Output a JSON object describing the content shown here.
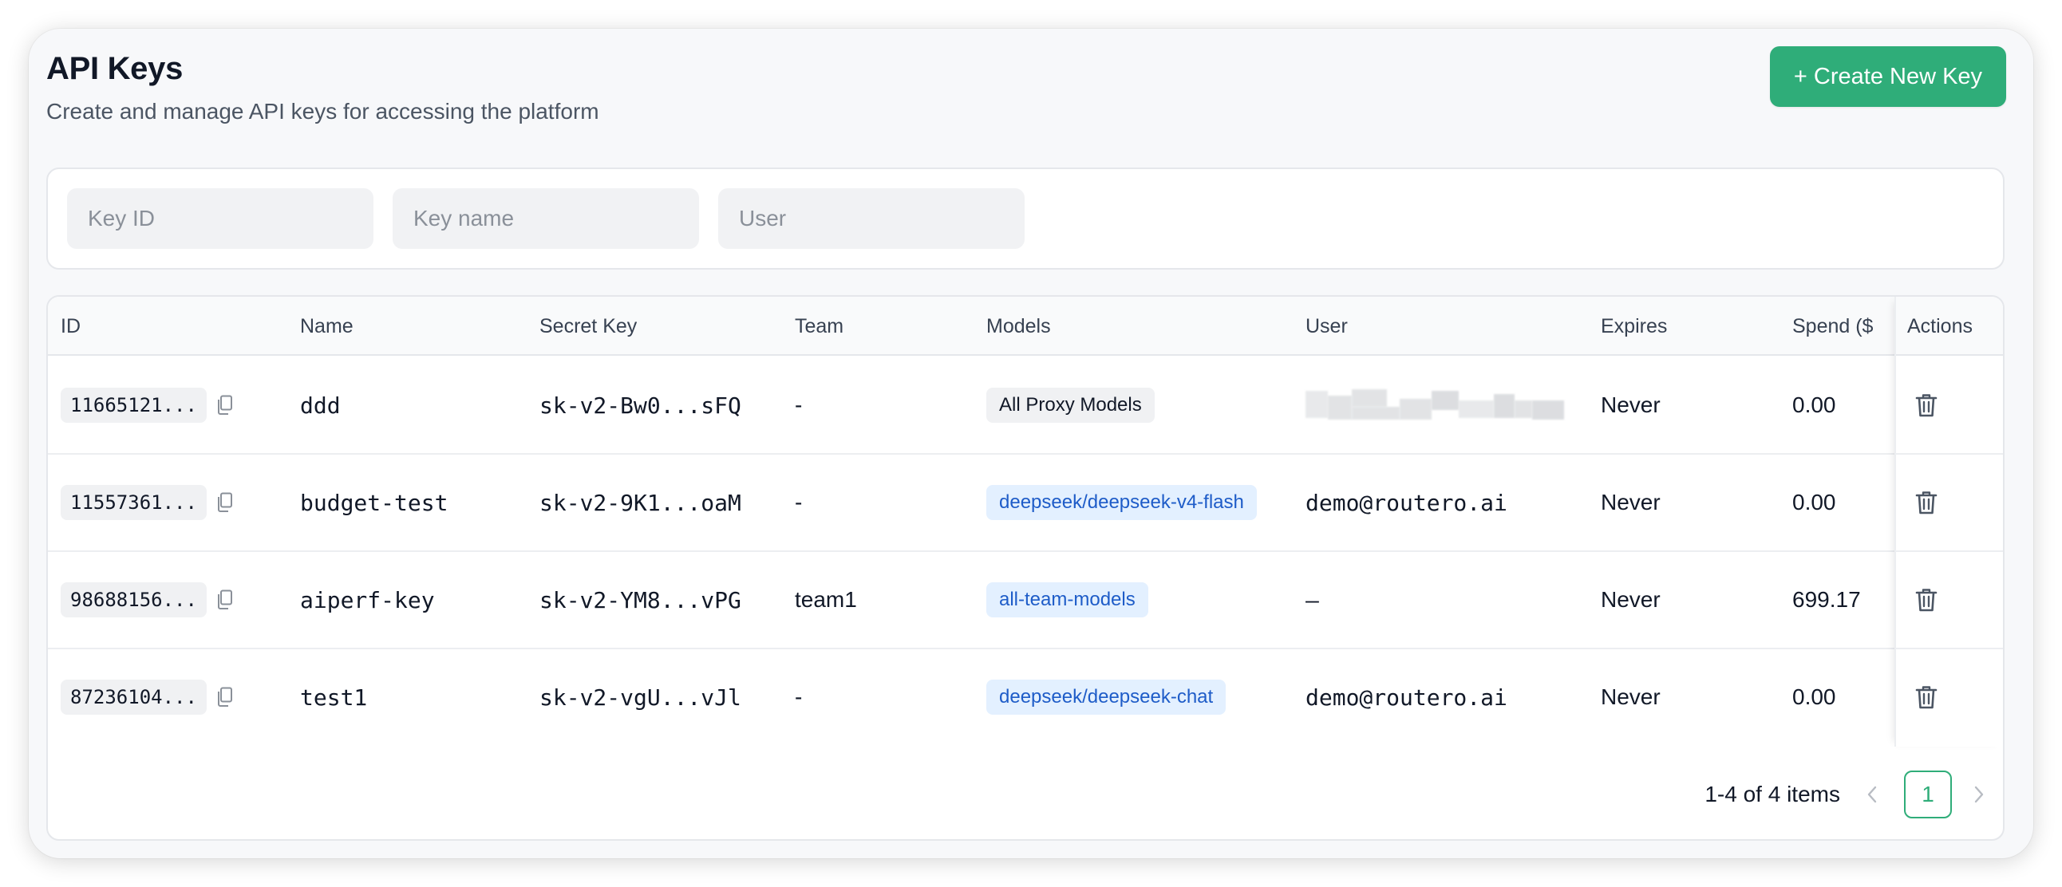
{
  "header": {
    "title": "API Keys",
    "subtitle": "Create and manage API keys for accessing the platform",
    "create_button": "+ Create New Key"
  },
  "filters": {
    "key_id_placeholder": "Key ID",
    "key_name_placeholder": "Key name",
    "user_placeholder": "User"
  },
  "table": {
    "columns": [
      "ID",
      "Name",
      "Secret Key",
      "Team",
      "Models",
      "User",
      "Expires",
      "Spend ($",
      "Actions"
    ],
    "rows": [
      {
        "id": "11665121...",
        "name": "ddd",
        "secret": "sk-v2-Bw0...sFQ",
        "team": "-",
        "model": "All Proxy Models",
        "model_style": "gray",
        "user": "",
        "user_redacted": true,
        "expires": "Never",
        "spend": "0.00"
      },
      {
        "id": "11557361...",
        "name": "budget-test",
        "secret": "sk-v2-9K1...oaM",
        "team": "-",
        "model": "deepseek/deepseek-v4-flash",
        "model_style": "blue",
        "user": "demo@routero.ai",
        "user_redacted": false,
        "expires": "Never",
        "spend": "0.00"
      },
      {
        "id": "98688156...",
        "name": "aiperf-key",
        "secret": "sk-v2-YM8...vPG",
        "team": "team1",
        "model": "all-team-models",
        "model_style": "blue",
        "user": "–",
        "user_redacted": false,
        "expires": "Never",
        "spend": "699.17"
      },
      {
        "id": "87236104...",
        "name": "test1",
        "secret": "sk-v2-vgU...vJl",
        "team": "-",
        "model": "deepseek/deepseek-chat",
        "model_style": "blue",
        "user": "demo@routero.ai",
        "user_redacted": false,
        "expires": "Never",
        "spend": "0.00"
      }
    ]
  },
  "pagination": {
    "summary": "1-4 of 4 items",
    "current_page": "1"
  },
  "colors": {
    "accent": "#2fad79",
    "tag_blue_bg": "#e3f0ff",
    "tag_blue_text": "#1e5cc8"
  },
  "icons": [
    "copy-icon",
    "trash-icon",
    "chevron-left-icon",
    "chevron-right-icon"
  ]
}
